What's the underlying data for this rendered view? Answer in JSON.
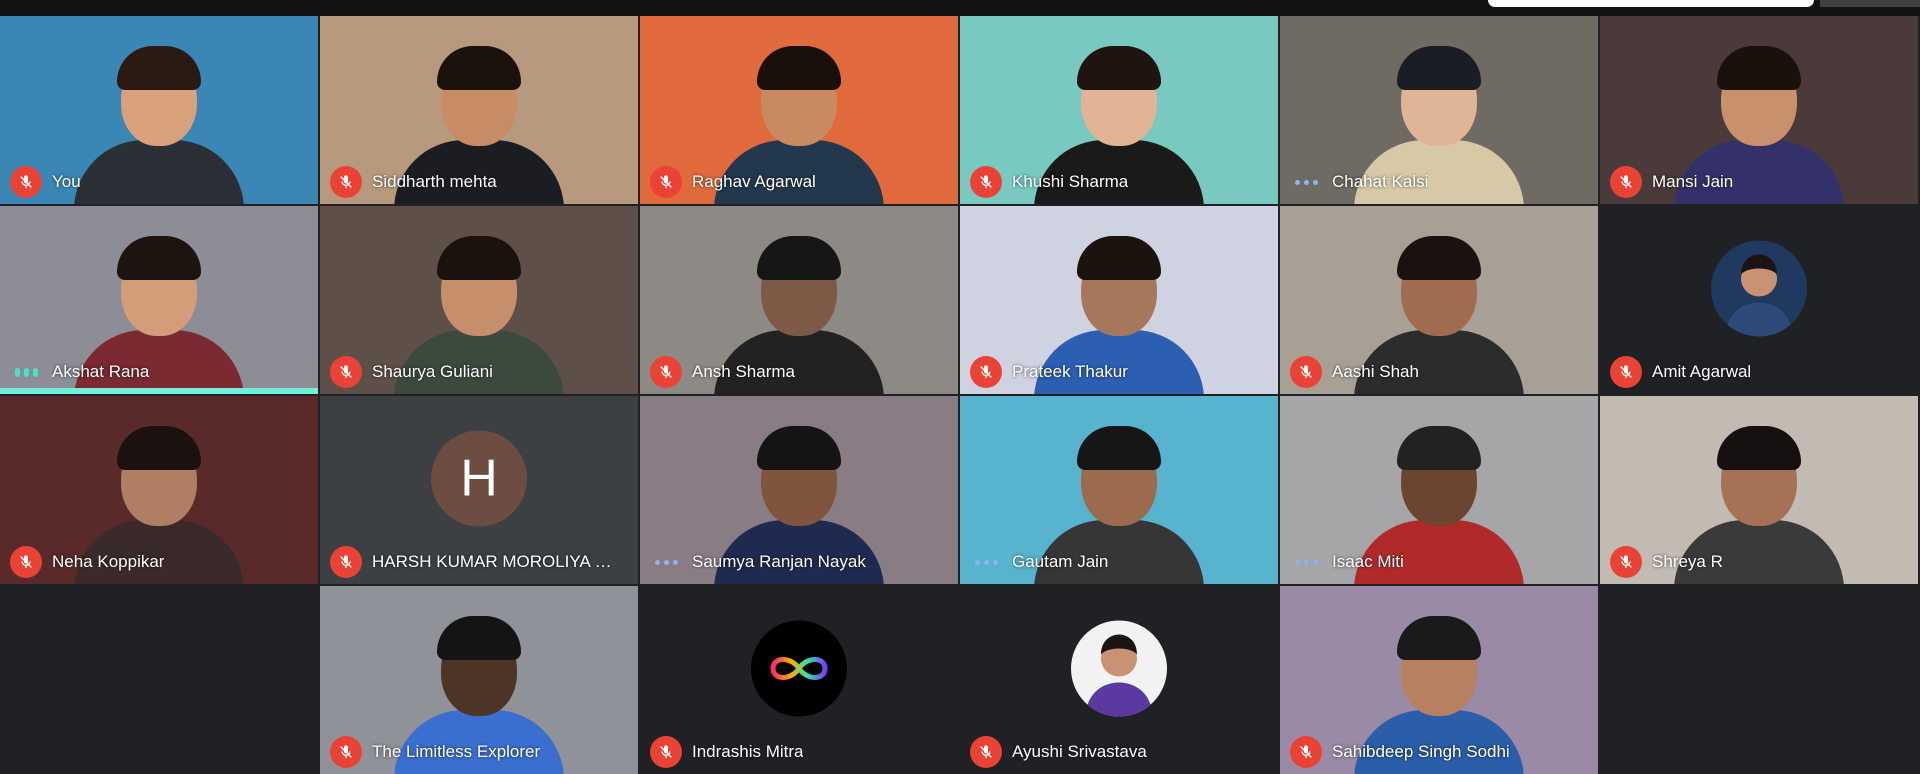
{
  "colors": {
    "muted_badge": "#ea4335",
    "tile_background": "#202124",
    "speaking_indicator": "#4ce0c8",
    "active_speaker_bar": "#6ff0d8"
  },
  "participants": [
    {
      "name": "You",
      "status": "muted",
      "bg": "#3a86b4",
      "skin": "#d9a27c",
      "hair": "#2a1a12",
      "shirt": "#2b2f36"
    },
    {
      "name": "Siddharth mehta",
      "status": "muted",
      "bg": "#b79a7e",
      "skin": "#c78c66",
      "hair": "#1c120c",
      "shirt": "#1c1d22"
    },
    {
      "name": "Raghav Agarwal",
      "status": "muted",
      "bg": "#e06a3c",
      "skin": "#c98a62",
      "hair": "#1a100b",
      "shirt": "#23384d"
    },
    {
      "name": "Khushi Sharma",
      "status": "muted",
      "bg": "#78c9c0",
      "skin": "#e2b395",
      "hair": "#1f1410",
      "shirt": "#1a1a1a"
    },
    {
      "name": "Chahat Kalsi",
      "status": "listening",
      "bg": "#6f6a62",
      "skin": "#e0b496",
      "hair": "#1b1d24",
      "shirt": "#d7c9a6"
    },
    {
      "name": "Mansi Jain",
      "status": "muted",
      "bg": "#4a3a3a",
      "skin": "#c8906c",
      "hair": "#1a100c",
      "shirt": "#33306a"
    },
    {
      "name": "Akshat Rana",
      "status": "speaking",
      "bg": "#8c8d96",
      "skin": "#d49d7a",
      "hair": "#1d140f",
      "shirt": "#7a2a30"
    },
    {
      "name": "Shaurya Guliani",
      "status": "muted",
      "bg": "#5e5048",
      "skin": "#c68e6b",
      "hair": "#1b120e",
      "shirt": "#3c4a3d"
    },
    {
      "name": "Ansh Sharma",
      "status": "muted",
      "bg": "#8d8a86",
      "skin": "#7d5a45",
      "hair": "#161616",
      "shirt": "#222222"
    },
    {
      "name": "Prateek Thakur",
      "status": "muted",
      "bg": "#cfd2e0",
      "skin": "#a7775b",
      "hair": "#1b130e",
      "shirt": "#2c5fb2"
    },
    {
      "name": "Aashi Shah",
      "status": "muted",
      "bg": "#a8a094",
      "skin": "#a06c50",
      "hair": "#1a120e",
      "shirt": "#2c2c2c"
    },
    {
      "name": "Amit Agarwal",
      "status": "muted",
      "avatar": "photo",
      "avatar_color": "#1f3a5e",
      "bg": "#202124"
    },
    {
      "name": "Neha Koppikar",
      "status": "muted",
      "bg": "#5a2a2a",
      "skin": "#b07e62",
      "hair": "#1b1210",
      "shirt": "#3b2a2a"
    },
    {
      "name": "HARSH KUMAR MOROLIYA BT...",
      "status": "muted",
      "avatar": "letter",
      "avatar_letter": "H",
      "avatar_color": "#6d4c41",
      "bg": "#3c4043"
    },
    {
      "name": "Saumya Ranjan Nayak",
      "status": "listening",
      "bg": "#8a7c84",
      "skin": "#7f553d",
      "hair": "#141414",
      "shirt": "#1f2a50"
    },
    {
      "name": "Gautam Jain",
      "status": "listening",
      "bg": "#58b3cf",
      "skin": "#9c6a4c",
      "hair": "#161616",
      "shirt": "#363636"
    },
    {
      "name": "Isaac Miti",
      "status": "listening",
      "bg": "#a6a6a8",
      "skin": "#6b4530",
      "hair": "#222222",
      "shirt": "#b02a2a"
    },
    {
      "name": "Shreya R",
      "status": "muted",
      "bg": "#c2bbb2",
      "skin": "#a57256",
      "hair": "#161010",
      "shirt": "#3a3a3a"
    },
    {
      "empty": true
    },
    {
      "name": "The Limitless Explorer",
      "status": "muted",
      "bg": "#8f9298",
      "skin": "#4c3426",
      "hair": "#141414",
      "shirt": "#3a6fd0"
    },
    {
      "name": "Indrashis Mitra",
      "status": "muted",
      "avatar": "infinity",
      "avatar_color": "#000000",
      "bg": "#202124"
    },
    {
      "name": "Ayushi Srivastava",
      "status": "muted",
      "avatar": "photo",
      "avatar_color": "#f2f2f2",
      "bg": "#202124"
    },
    {
      "name": "Sahibdeep Singh Sodhi",
      "status": "muted",
      "bg": "#9a8aa6",
      "skin": "#b7815f",
      "hair": "#1a1a1a",
      "shirt": "#2a5ea8"
    },
    {
      "empty": true
    }
  ]
}
